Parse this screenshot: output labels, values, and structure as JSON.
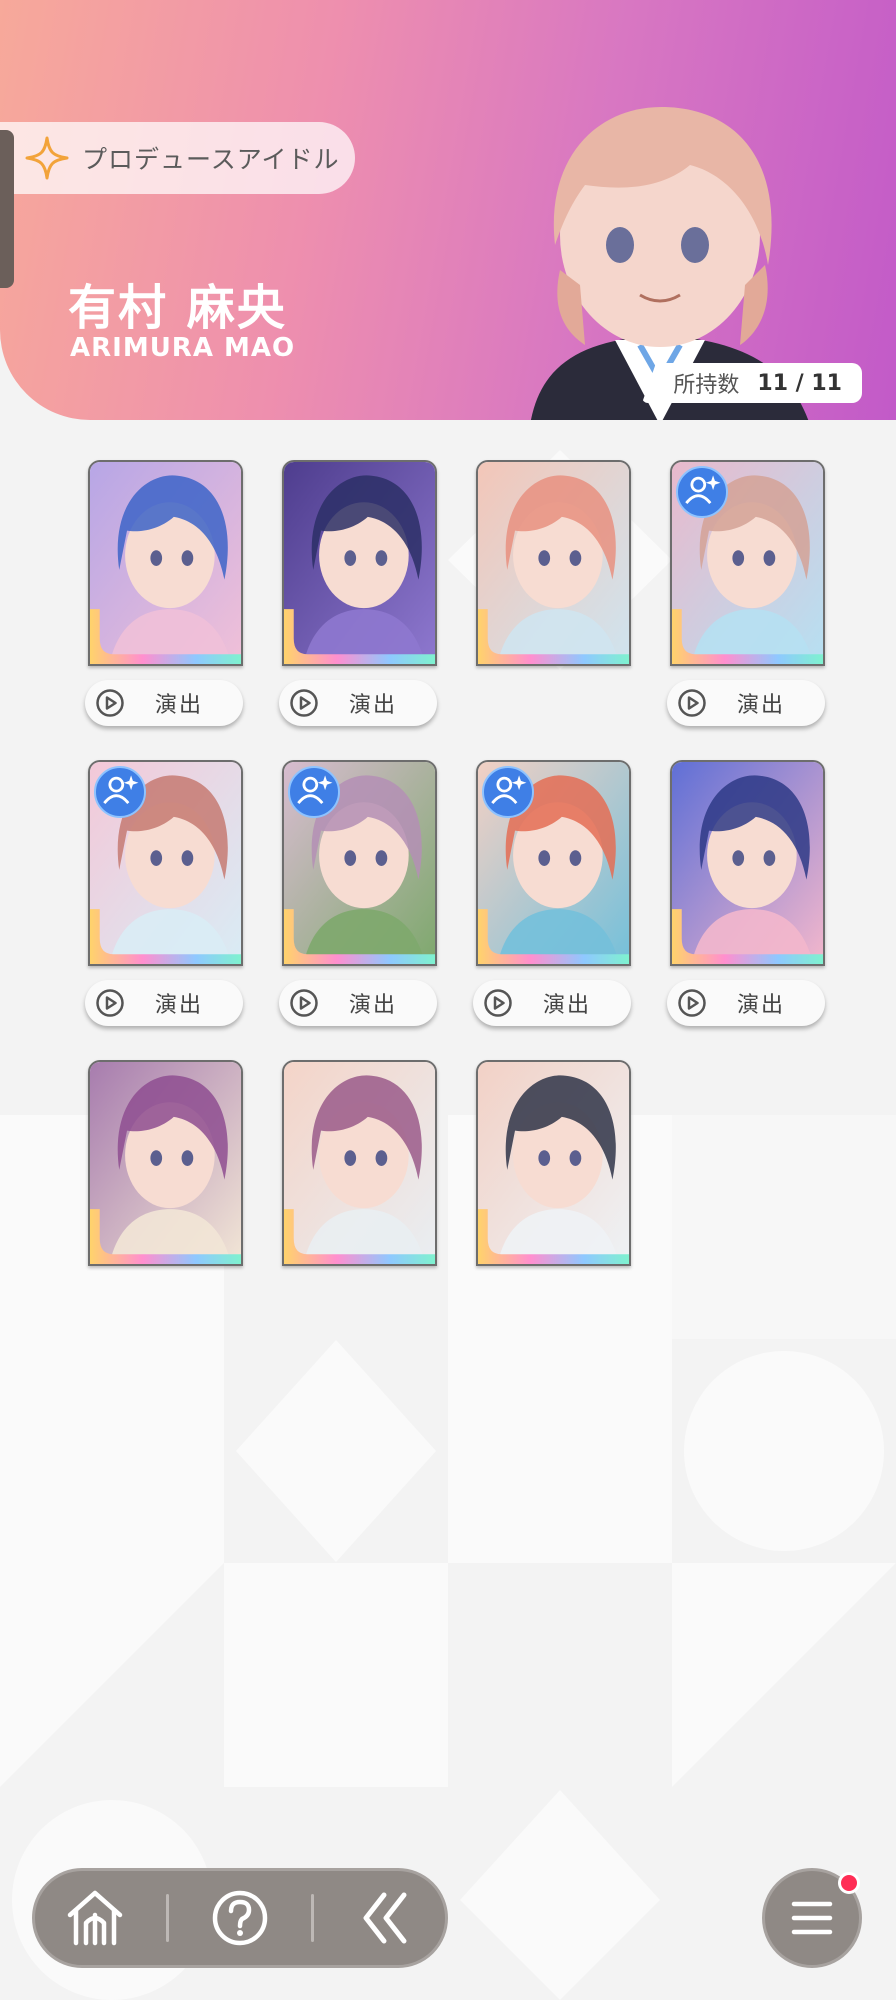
{
  "header": {
    "section_label": "プロデュースアイドル",
    "idol_name_jp": "有村 麻央",
    "idol_name_en": "ARIMURA MAO",
    "count_label": "所持数",
    "count_value": "11 / 11"
  },
  "cards": [
    {
      "name": "card-1",
      "plan_icon": false,
      "has_play": true,
      "play_label": "演出",
      "palette": [
        "#b7a6e6",
        "#f0c0d8",
        "#3d64c8"
      ]
    },
    {
      "name": "card-2",
      "plan_icon": false,
      "has_play": true,
      "play_label": "演出",
      "palette": [
        "#4e3d8e",
        "#8e78cf",
        "#2c2f66"
      ]
    },
    {
      "name": "card-3",
      "plan_icon": false,
      "has_play": false,
      "play_label": "",
      "palette": [
        "#f3c6b8",
        "#cfe4ef",
        "#e89080"
      ]
    },
    {
      "name": "card-4",
      "plan_icon": true,
      "has_play": true,
      "play_label": "演出",
      "palette": [
        "#e9b9cc",
        "#b6e0f2",
        "#d3a296"
      ]
    },
    {
      "name": "card-5",
      "plan_icon": true,
      "has_play": true,
      "play_label": "演出",
      "palette": [
        "#f3c8d8",
        "#d9ecf5",
        "#c57a72"
      ]
    },
    {
      "name": "card-6",
      "plan_icon": true,
      "has_play": true,
      "play_label": "演出",
      "palette": [
        "#d8bcd0",
        "#7ea86d",
        "#b48fb5"
      ]
    },
    {
      "name": "card-7",
      "plan_icon": true,
      "has_play": true,
      "play_label": "演出",
      "palette": [
        "#f2d0c4",
        "#74c0da",
        "#e46d55"
      ]
    },
    {
      "name": "card-8",
      "plan_icon": false,
      "has_play": true,
      "play_label": "演出",
      "palette": [
        "#5f6fd6",
        "#f3b7cc",
        "#2e3a86"
      ]
    },
    {
      "name": "card-9",
      "plan_icon": false,
      "has_play": false,
      "play_label": "",
      "palette": [
        "#a77cae",
        "#f2e6d6",
        "#8e4d90"
      ]
    },
    {
      "name": "card-10",
      "plan_icon": false,
      "has_play": false,
      "play_label": "",
      "palette": [
        "#f4d4c8",
        "#e9eef2",
        "#9a5a8a"
      ]
    },
    {
      "name": "card-11",
      "plan_icon": false,
      "has_play": false,
      "play_label": "",
      "palette": [
        "#f2d1c6",
        "#eef2f5",
        "#2f3448"
      ]
    }
  ],
  "nav": {
    "items": [
      {
        "name": "home-button",
        "icon": "home-icon"
      },
      {
        "name": "help-button",
        "icon": "help-icon"
      },
      {
        "name": "back-button",
        "icon": "back-double-chevron-icon"
      }
    ],
    "menu_icon": "menu-icon",
    "has_notification": true
  },
  "colors": {
    "header_gradient_start": "#f7a99a",
    "header_gradient_end": "#c25ac8",
    "nav_bg": "#8f8985",
    "notification": "#ff2d55",
    "plan_icon": "#3f7fe6"
  }
}
